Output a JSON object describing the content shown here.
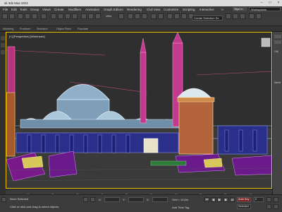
{
  "app": {
    "title": "sk 3ds Max 2021"
  },
  "menu": {
    "items": [
      "File",
      "Edit",
      "Tools",
      "Group",
      "Views",
      "Create",
      "Modifiers",
      "Animation",
      "Graph Editors",
      "Rendering",
      "Civil View",
      "Customize",
      "Scripting",
      "Interactive"
    ],
    "selection_set": "Create Selection Se",
    "sign_in": "Sign In",
    "workspace": "Workspaces"
  },
  "toolbar": {
    "view_dropdown": "View"
  },
  "ribbon": {
    "tabs": [
      "Modeling",
      "Freeform",
      "Selection",
      "Object Paint",
      "Populate"
    ]
  },
  "viewport": {
    "label": "[+] [Perspective] [Wireframe]"
  },
  "command_panel": {
    "labels": [
      "Obj",
      "Name"
    ]
  },
  "timeline": {
    "ticks": [
      "10",
      "20",
      "30",
      "40",
      "50",
      "60",
      "70",
      "80",
      "90",
      "100"
    ]
  },
  "status": {
    "selected": "None Selected",
    "prompt": "Click or click-and-drag to select objects",
    "x_label": "X:",
    "y_label": "Y:",
    "z_label": "Z:",
    "grid": "Grid = 10,0m",
    "add_time_tag": "Add Time Tag",
    "auto_key": "Auto Key",
    "selected_dropdown": "Selected",
    "frame_value": "0"
  }
}
